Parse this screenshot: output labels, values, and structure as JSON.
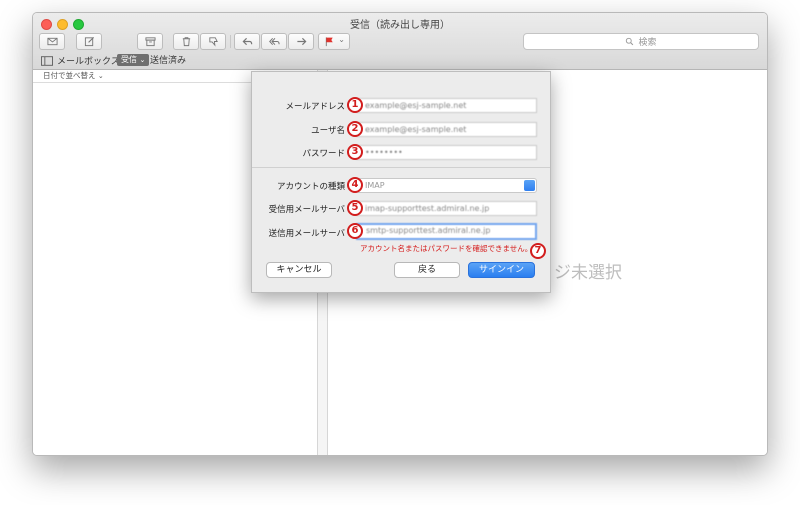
{
  "window": {
    "title": "受信（読み出し専用）"
  },
  "toolbar": {
    "search_placeholder": "検索"
  },
  "favorites": {
    "mailbox_label": "メールボックス",
    "inbox_label": "受信",
    "sent_label": "送信済み"
  },
  "list": {
    "sort_label": "日付で並べ替え"
  },
  "viewer": {
    "no_message_text": "ジ未選択"
  },
  "dialog": {
    "email_label": "メールアドレス",
    "email_value": "example@esj-sample.net",
    "username_label": "ユーザ名",
    "username_value": "example@esj-sample.net",
    "password_label": "パスワード",
    "password_value": "••••••••",
    "account_type_label": "アカウントの種類",
    "account_type_value": "IMAP",
    "incoming_label": "受信用メールサーバ",
    "incoming_value": "imap-supporttest.admiral.ne.jp",
    "outgoing_label": "送信用メールサーバ",
    "outgoing_value": "smtp-supporttest.admiral.ne.jp",
    "error_text": "アカウント名またはパスワードを確認できません。",
    "cancel_label": "キャンセル",
    "back_label": "戻る",
    "signin_label": "サインイン"
  },
  "callouts": [
    "1",
    "2",
    "3",
    "4",
    "5",
    "6",
    "7"
  ],
  "colors": {
    "callout": "#d21d1d",
    "accent": "#2f7ff0",
    "error": "#d51a1a"
  }
}
